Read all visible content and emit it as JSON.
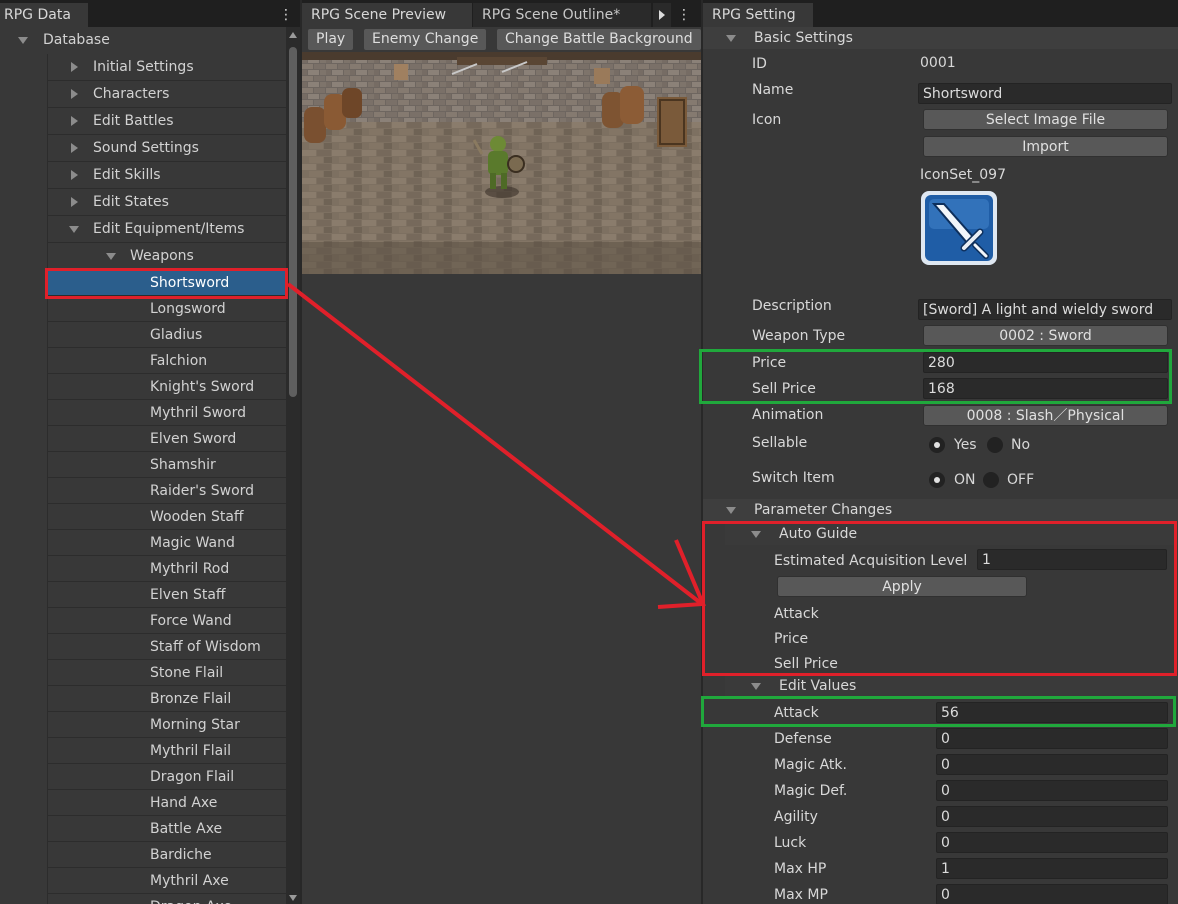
{
  "left_panel": {
    "tab": "RPG Data",
    "tree": {
      "root": "Database",
      "categories": [
        "Initial Settings",
        "Characters",
        "Edit Battles",
        "Sound Settings",
        "Edit Skills",
        "Edit States",
        "Edit Equipment/Items"
      ],
      "subcategory": "Weapons",
      "weapons": [
        "Shortsword",
        "Longsword",
        "Gladius",
        "Falchion",
        "Knight's Sword",
        "Mythril Sword",
        "Elven Sword",
        "Shamshir",
        "Raider's Sword",
        "Wooden Staff",
        "Magic Wand",
        "Mythril Rod",
        "Elven Staff",
        "Force Wand",
        "Staff of Wisdom",
        "Stone Flail",
        "Bronze Flail",
        "Morning Star",
        "Mythril Flail",
        "Dragon Flail",
        "Hand Axe",
        "Battle Axe",
        "Bardiche",
        "Mythril Axe",
        "Dragon Axe"
      ],
      "selected": "Shortsword"
    }
  },
  "middle_panel": {
    "tabs": [
      "RPG Scene Preview",
      "RPG Scene Outline*"
    ],
    "toolbar": {
      "play": "Play",
      "enemy_change": "Enemy Change",
      "change_background": "Change Battle Background"
    }
  },
  "right_panel": {
    "tab": "RPG Setting",
    "basic": {
      "title": "Basic Settings",
      "id_label": "ID",
      "id_value": "0001",
      "name_label": "Name",
      "name_value": "Shortsword",
      "icon_label": "Icon",
      "select_image_button": "Select Image File",
      "import_button": "Import",
      "icon_file": "IconSet_097",
      "description_label": "Description",
      "description_value": "[Sword] A light and wieldy sword",
      "weapon_type_label": "Weapon Type",
      "weapon_type_value": "0002 : Sword",
      "price_label": "Price",
      "price_value": "280",
      "sell_price_label": "Sell Price",
      "sell_price_value": "168",
      "animation_label": "Animation",
      "animation_value": "0008 : Slash／Physical",
      "sellable_label": "Sellable",
      "sellable_yes": "Yes",
      "sellable_no": "No",
      "switch_item_label": "Switch Item",
      "switch_on": "ON",
      "switch_off": "OFF"
    },
    "params": {
      "title": "Parameter Changes",
      "auto_guide": {
        "title": "Auto Guide",
        "level_label": "Estimated Acquisition Level",
        "level_value": "1",
        "apply_button": "Apply",
        "attack_label": "Attack",
        "price_label": "Price",
        "sell_price_label": "Sell Price"
      },
      "edit_values": {
        "title": "Edit Values",
        "attack_label": "Attack",
        "attack_value": "56",
        "defense_label": "Defense",
        "defense_value": "0",
        "magic_atk_label": "Magic Atk.",
        "magic_atk_value": "0",
        "magic_def_label": "Magic Def.",
        "magic_def_value": "0",
        "agility_label": "Agility",
        "agility_value": "0",
        "luck_label": "Luck",
        "luck_value": "0",
        "max_hp_label": "Max HP",
        "max_hp_value": "1",
        "max_mp_label": "Max MP",
        "max_mp_value": "0"
      }
    }
  },
  "colors": {
    "highlight_red": "#e0202a",
    "highlight_green": "#20a83c",
    "selection_blue": "#2b5e8c"
  }
}
